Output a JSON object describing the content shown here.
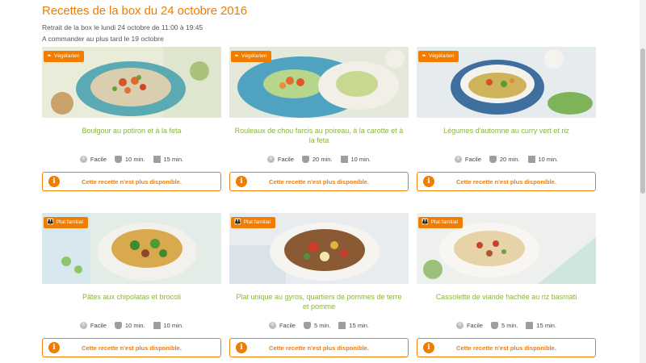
{
  "header": {
    "title": "Recettes de la box du 24 octobre 2016",
    "pickup": "Retrait de la box le lundi 24 octobre de 11:00 à 19:45",
    "deadline": "A commander au plus tard le 19 octobre"
  },
  "colors": {
    "accent": "#f07d00",
    "recipe_title": "#8bb33e"
  },
  "unavailable_text": "Cette recette n'est plus disponible.",
  "recipes": [
    {
      "badge": "Végétarien",
      "badge_icon": "leaf-icon",
      "title": "Boulgour au potiron et à la feta",
      "difficulty": "Facile",
      "prep": "10 min.",
      "cook": "15 min."
    },
    {
      "badge": "Végétarien",
      "badge_icon": "leaf-icon",
      "title": "Rouleaux de chou farcis au poireau, à la carotte et à la feta",
      "difficulty": "Facile",
      "prep": "20 min.",
      "cook": "10 min."
    },
    {
      "badge": "Végétarien",
      "badge_icon": "leaf-icon",
      "title": "Légumes d'automne au curry vert et riz",
      "difficulty": "Facile",
      "prep": "20 min.",
      "cook": "10 min."
    },
    {
      "badge": "Plat familial",
      "badge_icon": "family-icon",
      "title": "Pâtes aux chipolatas et brocoli",
      "difficulty": "Facile",
      "prep": "10 min.",
      "cook": "10 min."
    },
    {
      "badge": "Plat familial",
      "badge_icon": "family-icon",
      "title": "Plat unique au gyros, quartiers de pommes de terre et pomme",
      "difficulty": "Facile",
      "prep": "5 min.",
      "cook": "15 min."
    },
    {
      "badge": "Plat familial",
      "badge_icon": "family-icon",
      "title": "Cassolette de viande hachée au riz basmati",
      "difficulty": "Facile",
      "prep": "5 min.",
      "cook": "15 min."
    }
  ]
}
